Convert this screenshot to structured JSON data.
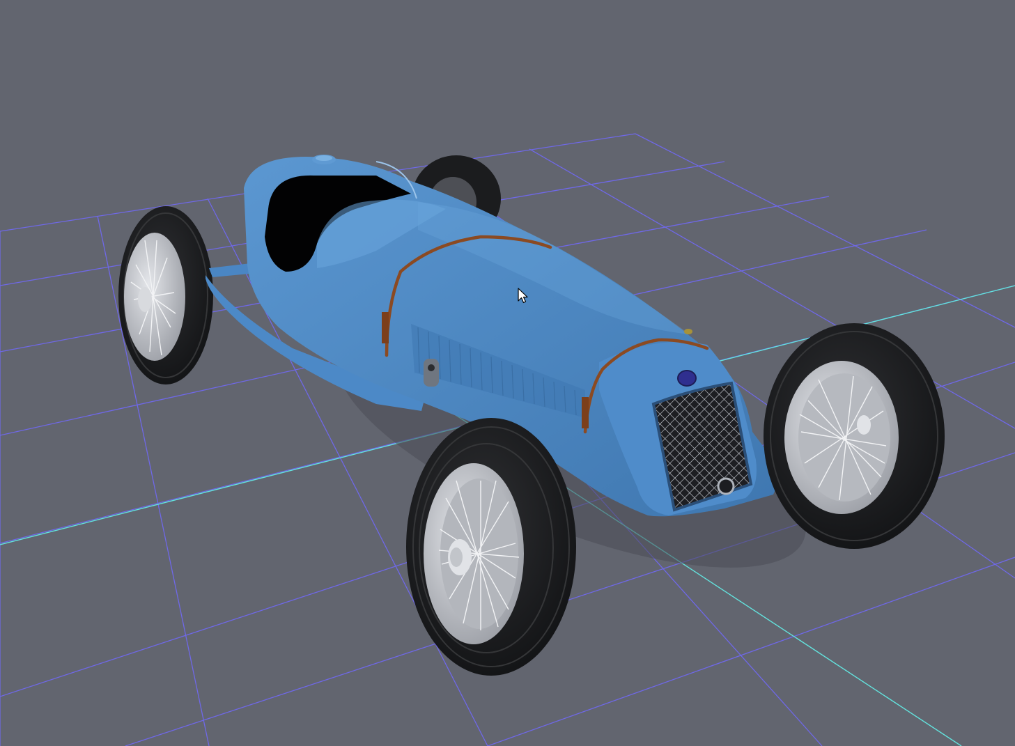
{
  "viewport": {
    "background_color": "#62656f",
    "grid_color": "#6f68e8",
    "axis_color": "#63e3de"
  },
  "model": {
    "body_color": "#4c89c7",
    "tire_color": "#1b1c1e",
    "rim_color": "#c9cbd0",
    "strap_color": "#8b4a22",
    "badge_color": "#2f2f8f"
  },
  "cursor": {
    "icon": "arrow-cursor-icon"
  }
}
